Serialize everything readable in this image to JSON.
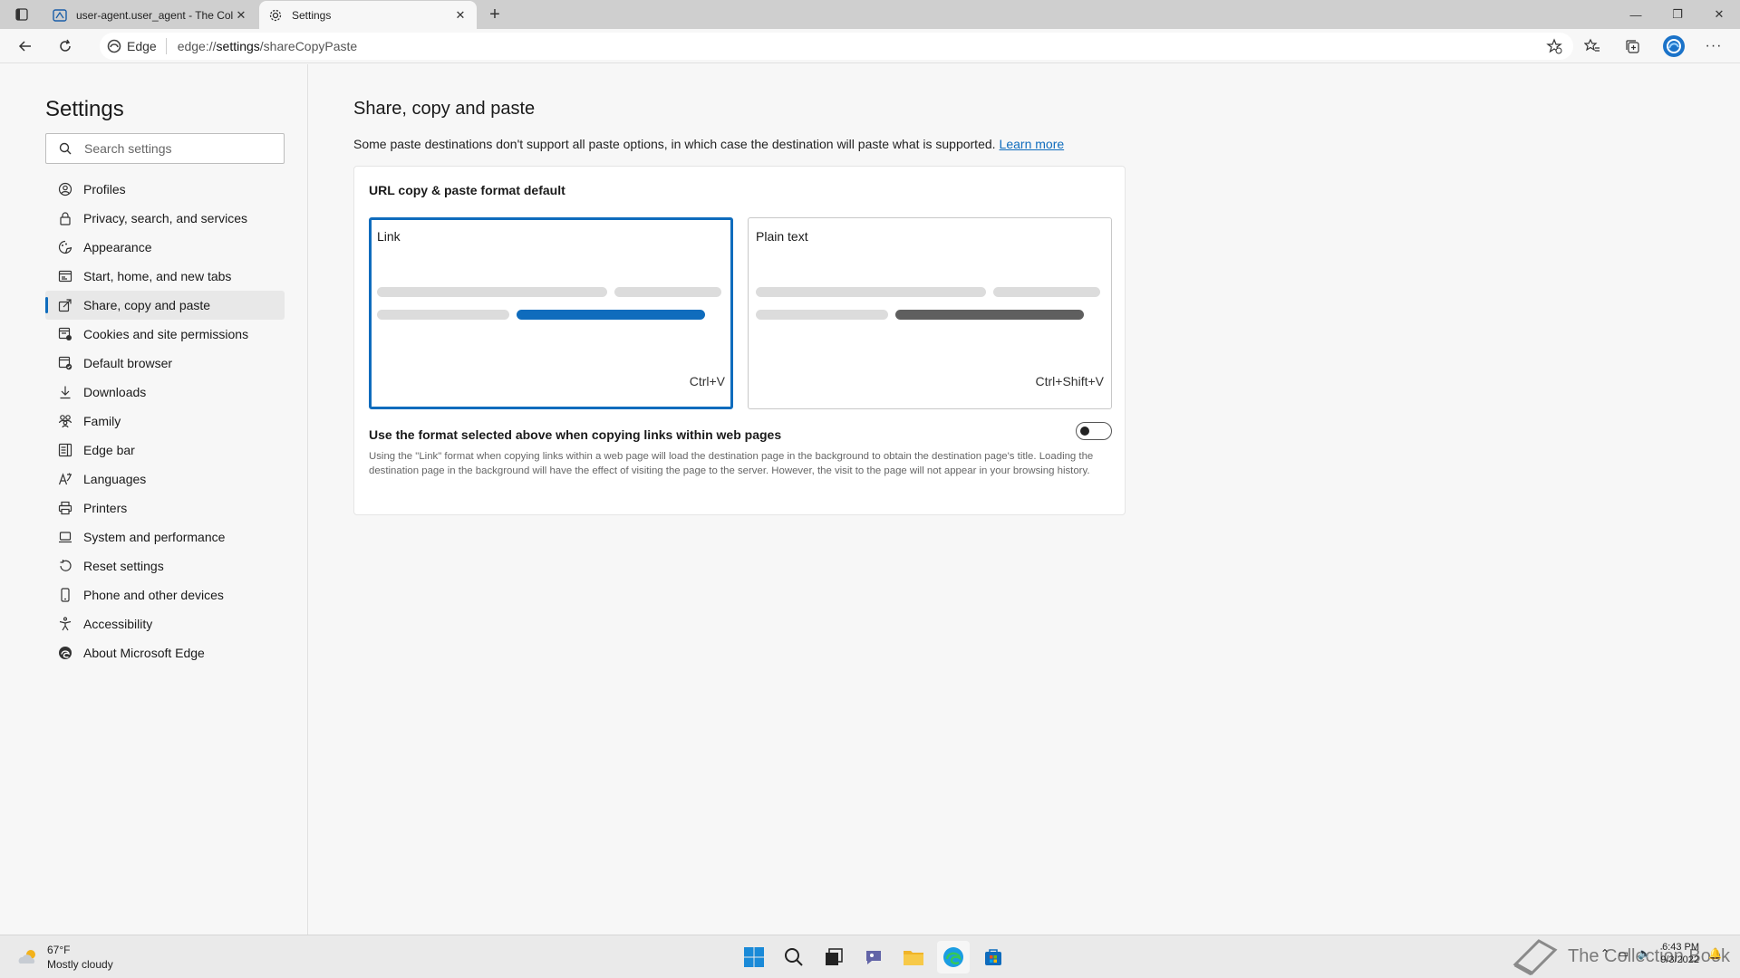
{
  "browser": {
    "tabs": [
      {
        "title": "user-agent.user_agent - The Collection Book",
        "active": false
      },
      {
        "title": "Settings",
        "active": true
      }
    ],
    "address": {
      "site_label": "Edge",
      "url_prefix": "edge://",
      "url_main": "settings",
      "url_rest": "/shareCopyPaste"
    }
  },
  "sidebar": {
    "title": "Settings",
    "search_placeholder": "Search settings",
    "items": [
      {
        "label": "Profiles",
        "icon": "profile-icon"
      },
      {
        "label": "Privacy, search, and services",
        "icon": "lock-icon"
      },
      {
        "label": "Appearance",
        "icon": "appearance-icon"
      },
      {
        "label": "Start, home, and new tabs",
        "icon": "home-tabs-icon"
      },
      {
        "label": "Share, copy and paste",
        "icon": "share-icon",
        "active": true
      },
      {
        "label": "Cookies and site permissions",
        "icon": "cookies-icon"
      },
      {
        "label": "Default browser",
        "icon": "default-browser-icon"
      },
      {
        "label": "Downloads",
        "icon": "download-icon"
      },
      {
        "label": "Family",
        "icon": "family-icon"
      },
      {
        "label": "Edge bar",
        "icon": "edge-bar-icon"
      },
      {
        "label": "Languages",
        "icon": "languages-icon"
      },
      {
        "label": "Printers",
        "icon": "printer-icon"
      },
      {
        "label": "System and performance",
        "icon": "laptop-icon"
      },
      {
        "label": "Reset settings",
        "icon": "reset-icon"
      },
      {
        "label": "Phone and other devices",
        "icon": "phone-icon"
      },
      {
        "label": "Accessibility",
        "icon": "accessibility-icon"
      },
      {
        "label": "About Microsoft Edge",
        "icon": "edge-logo-icon"
      }
    ]
  },
  "main": {
    "title": "Share, copy and paste",
    "description": "Some paste destinations don't support all paste options, in which case the destination will paste what is supported.",
    "learn_more": "Learn more",
    "card": {
      "title": "URL copy & paste format default",
      "options": [
        {
          "label": "Link",
          "shortcut": "Ctrl+V",
          "selected": true
        },
        {
          "label": "Plain text",
          "shortcut": "Ctrl+Shift+V",
          "selected": false
        }
      ],
      "toggle_label": "Use the format selected above when copying links within web pages",
      "toggle_on": false,
      "toggle_description": "Using the \"Link\" format when copying links within a web page will load the destination page in the background to obtain the destination page's title. Loading the destination page in the background will have the effect of visiting the page to the server. However, the visit to the page will not appear in your browsing history."
    }
  },
  "taskbar": {
    "weather_temp": "67°F",
    "weather_desc": "Mostly cloudy",
    "time": "6:43 PM",
    "date": "9/3/2022",
    "watermark": "The Collection Book"
  },
  "colors": {
    "accent": "#0f6cbd",
    "plain_bar": "#5f5f5f"
  }
}
